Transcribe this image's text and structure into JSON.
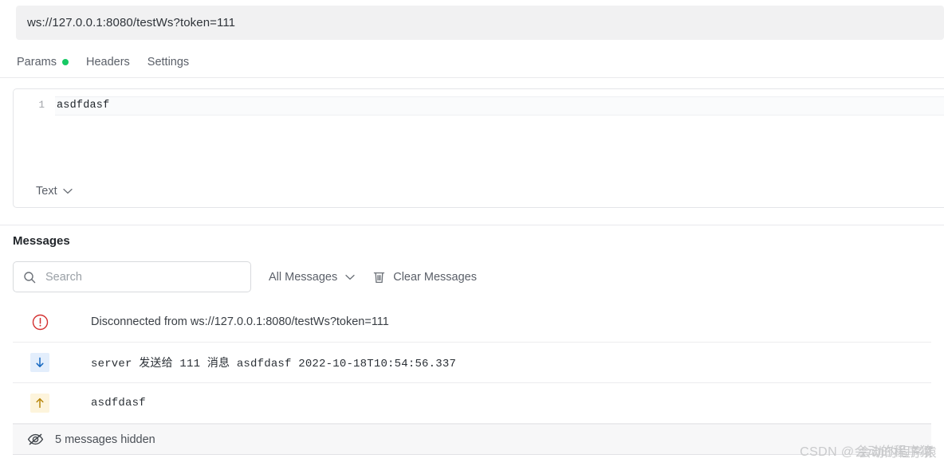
{
  "url_bar": {
    "value": "ws://127.0.0.1:8080/testWs?token=111",
    "placeholder": "Enter WebSocket URL"
  },
  "tabs": [
    {
      "label": "Params",
      "has_dot": true,
      "dot_color": "#17c964"
    },
    {
      "label": "Headers",
      "has_dot": false
    },
    {
      "label": "Settings",
      "has_dot": false
    }
  ],
  "editor": {
    "line_number": "1",
    "content": "asdfdasf",
    "format_label": "Text",
    "format_chevron_icon": "chevron-down-icon"
  },
  "messages": {
    "section_title": "Messages",
    "search": {
      "placeholder": "Search",
      "value": "",
      "icon": "search-icon"
    },
    "filter": {
      "label": "All Messages",
      "icon": "chevron-down-icon"
    },
    "clear": {
      "label": "Clear Messages",
      "icon": "trash-icon"
    },
    "rows": [
      {
        "kind": "status",
        "icon": "alert-circle-icon",
        "icon_color": "#d32f2f",
        "text": "Disconnected from ws://127.0.0.1:8080/testWs?token=111",
        "mono": false
      },
      {
        "kind": "incoming",
        "icon": "arrow-down-icon",
        "icon_color": "#1668c1",
        "badge_color": "#e3eefc",
        "text": "server 发送给 111 消息 asdfdasf 2022-10-18T10:54:56.337",
        "mono": true
      },
      {
        "kind": "outgoing",
        "icon": "arrow-up-icon",
        "icon_color": "#b8860b",
        "badge_color": "#fdf4dc",
        "text": "asdfdasf",
        "mono": true
      }
    ],
    "hidden_bar": {
      "icon": "eye-off-icon",
      "label": "5 messages hidden"
    }
  },
  "watermark": {
    "prefix": "CSDN @",
    "name_a": "会动的程序猿",
    "name_b": "会动的程序猿"
  }
}
